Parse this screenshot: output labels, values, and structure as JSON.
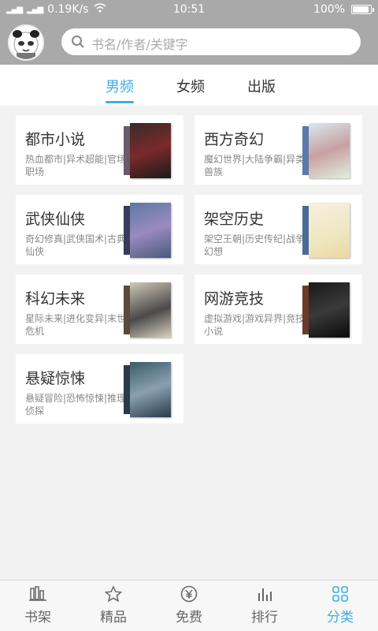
{
  "status": {
    "speed": "0.19K/s",
    "time": "10:51",
    "battery": "100%",
    "battery_level": 1.0
  },
  "search": {
    "placeholder": "书名/作者/关键字"
  },
  "tabs": [
    {
      "label": "男频"
    },
    {
      "label": "女频"
    },
    {
      "label": "出版"
    }
  ],
  "categories": [
    {
      "title": "都市小说",
      "sub": "热血都市|异术超能|官场职场"
    },
    {
      "title": "西方奇幻",
      "sub": "魔幻世界|大陆争霸|异类兽族"
    },
    {
      "title": "武侠仙侠",
      "sub": "奇幻修真|武侠国术|古典仙侠"
    },
    {
      "title": "架空历史",
      "sub": "架空王朝|历史传纪|战争幻想"
    },
    {
      "title": "科幻未来",
      "sub": "星际未来|进化变异|末世危机"
    },
    {
      "title": "网游竞技",
      "sub": "虚拟游戏|游戏异界|竞技小说"
    },
    {
      "title": "悬疑惊悚",
      "sub": "悬疑冒险|恐怖惊悚|推理侦探"
    }
  ],
  "nav": [
    {
      "label": "书架"
    },
    {
      "label": "精品"
    },
    {
      "label": "免费"
    },
    {
      "label": "排行"
    },
    {
      "label": "分类"
    }
  ],
  "colors": {
    "accent": "#3aaee6",
    "header": "#a9a9a9"
  }
}
